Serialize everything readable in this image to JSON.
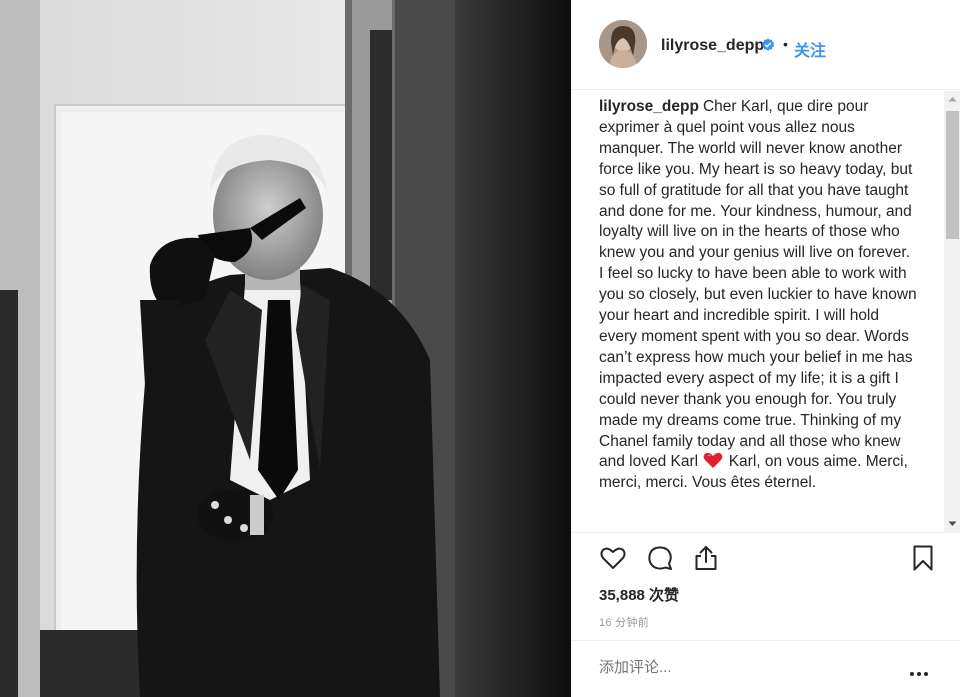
{
  "post": {
    "username": "lilyrose_depp",
    "follow_label": "关注",
    "separator": "•",
    "caption_username": "lilyrose_depp",
    "caption_part1": "Cher Karl, que dire pour exprimer à quel point vous allez nous manquer. The world will never know another force like you. My heart is so heavy today, but so full of gratitude for all that you have taught and done for me. Your kindness, humour, and loyalty will live on in the hearts of those who knew you and your genius will live on forever. I feel so lucky to have been able to work with you so closely, but even luckier to have known your heart and incredible spirit. I will hold every moment spent with you so dear. Words can’t express how much your belief in me has impacted every aspect of my life; it is a gift I could never thank you enough for. You truly made my dreams come true. Thinking of my Chanel family today and all those who knew and loved Karl",
    "caption_part2": "Karl, on vous aime. Merci, merci, merci. Vous êtes éternel.",
    "likes": "35,888 次赞",
    "timestamp": "16 分钟前",
    "comment_placeholder": "添加评论...",
    "accent_color": "#3897f0",
    "heart_emoji_color": "#e0202a",
    "icons": [
      "verified-badge-icon",
      "heart-icon",
      "comment-icon",
      "share-icon",
      "bookmark-icon",
      "more-options-icon",
      "red-heart-emoji-icon"
    ]
  }
}
